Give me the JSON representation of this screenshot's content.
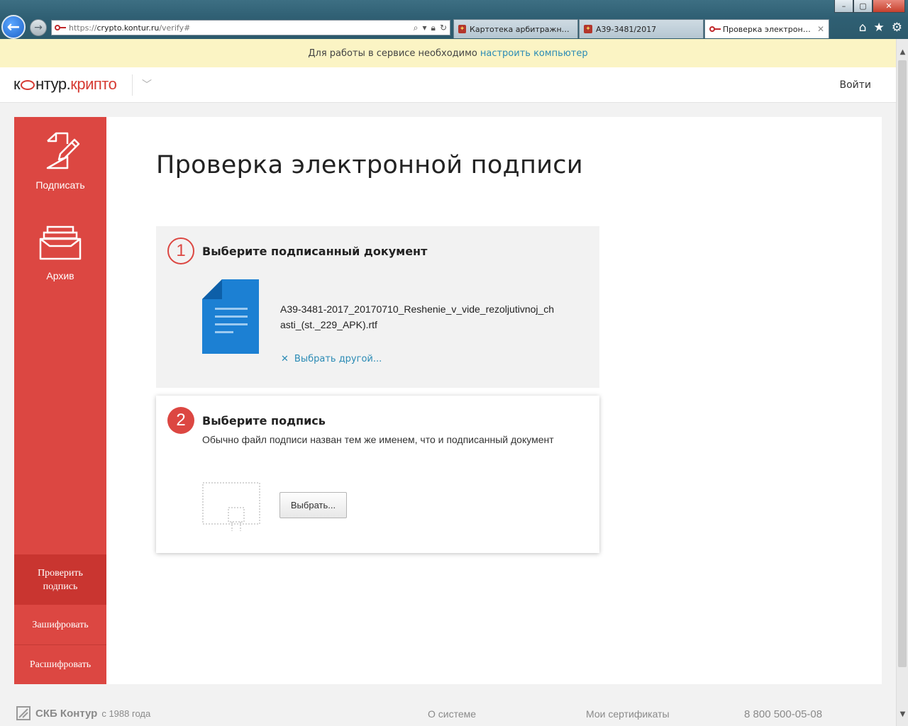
{
  "browser": {
    "url_prefix": "https://",
    "url_host": "crypto.kontur.ru",
    "url_path": "/verify#",
    "tabs": [
      {
        "label": "Картотека арбитражных ..."
      },
      {
        "label": "А39-3481/2017"
      },
      {
        "label": "Проверка электронно..."
      }
    ],
    "window_controls": {
      "minimize": "–",
      "maximize": "▢",
      "close": "✕"
    }
  },
  "notice": {
    "text": "Для работы в сервисе необходимо",
    "link": "настроить компьютер"
  },
  "header": {
    "logo_k": "к",
    "logo_rest": "нтур",
    "logo_dot": ".",
    "logo_product": "крипто",
    "login": "Войти"
  },
  "sidebar": {
    "sign": "Подписать",
    "archive": "Архив",
    "verify": "Проверить подпись",
    "encrypt": "Зашифровать",
    "decrypt": "Расшифровать"
  },
  "main": {
    "title": "Проверка электронной подписи",
    "step1": {
      "number": "1",
      "title": "Выберите подписанный документ",
      "filename": "А39-3481-2017_20170710_Reshenie_v_vide_rezoljutivnoj_chasti_(st._229_APK).rtf",
      "choose_other": "Выбрать другой..."
    },
    "step2": {
      "number": "2",
      "title": "Выберите подпись",
      "hint": "Обычно файл подписи назван тем же именем, что и подписанный документ",
      "button": "Выбрать..."
    }
  },
  "footer": {
    "brand": "СКБ Контур",
    "since": "с 1988 года",
    "about": "О системе",
    "certs": "Мои сертификаты",
    "phone": "8 800 500-05-08"
  },
  "colors": {
    "accent_red": "#dc4742",
    "link_blue": "#2b8bb5",
    "doc_blue": "#1c80d3",
    "notice_bg": "#fbf4c4"
  }
}
